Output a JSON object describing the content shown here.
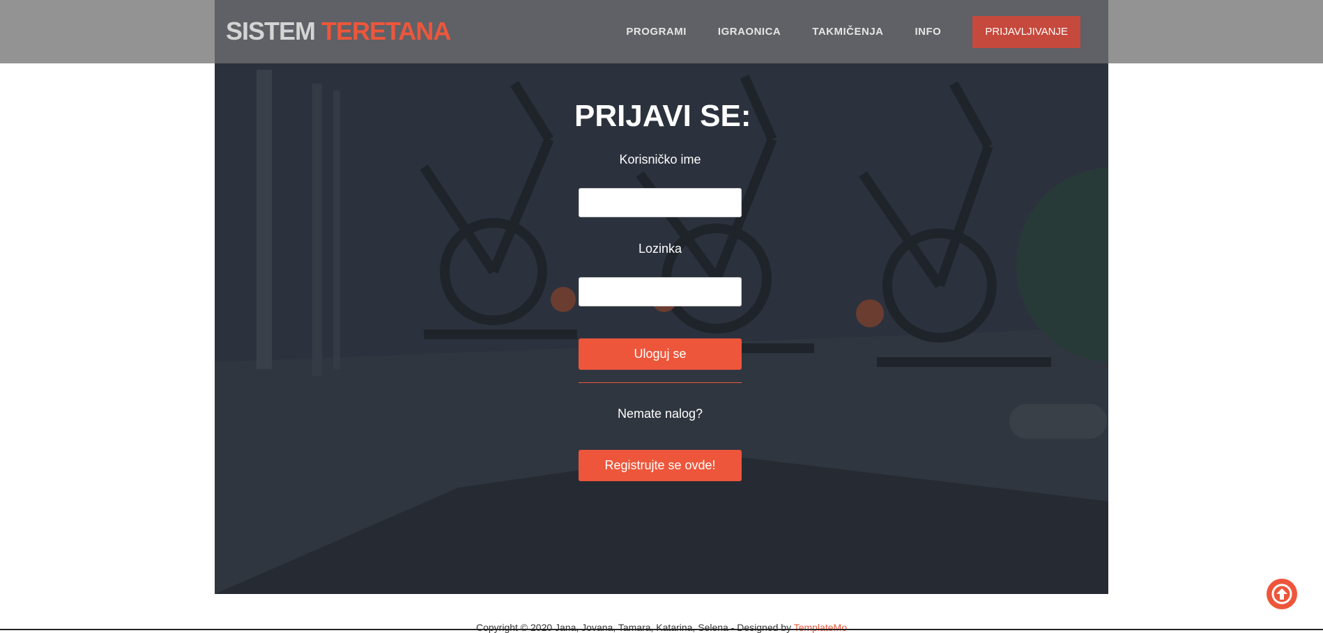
{
  "header": {
    "logo_part1": "SISTEM",
    "logo_part2": "TERETANA",
    "nav": [
      {
        "label": "PROGRAMI"
      },
      {
        "label": "IGRAONICA"
      },
      {
        "label": "TAKMIČENJA"
      },
      {
        "label": "INFO"
      }
    ],
    "login_label": "PRIJAVLJIVANJE"
  },
  "login_form": {
    "title": "PRIJAVI SE:",
    "username_label": "Korisničko ime",
    "username_value": "",
    "password_label": "Lozinka",
    "password_value": "",
    "submit_label": "Uloguj se",
    "no_account_text": "Nematе nalog?",
    "register_label": "Registrujte se ovde!"
  },
  "footer": {
    "copyright": "Copyright © 2020 Jana, Jovana, Tamara, Katarina, Selena - Designed by ",
    "designer_link": "TemplateMo"
  },
  "icons": {
    "scroll_top": "arrow-up-circle-icon"
  },
  "colors": {
    "accent": "#ed563b",
    "header": "#5f6166",
    "hero": "#2b313c"
  }
}
